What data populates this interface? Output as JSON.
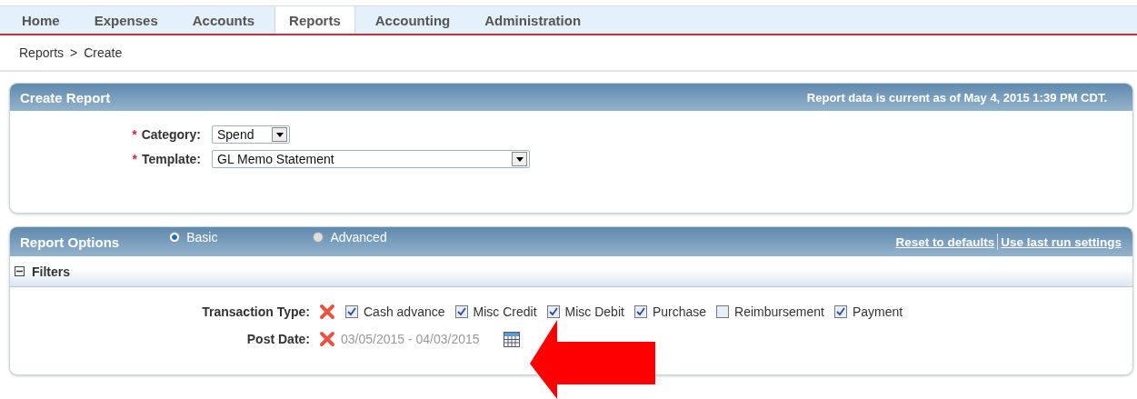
{
  "nav": {
    "tabs": [
      {
        "label": "Home",
        "selected": false
      },
      {
        "label": "Expenses",
        "selected": false
      },
      {
        "label": "Accounts",
        "selected": false
      },
      {
        "label": "Reports",
        "selected": true
      },
      {
        "label": "Accounting",
        "selected": false
      },
      {
        "label": "Administration",
        "selected": false
      }
    ]
  },
  "breadcrumb": {
    "items": [
      "Reports",
      "Create"
    ],
    "separator": ">"
  },
  "create_report": {
    "title": "Create Report",
    "note": "Report data is current as of May 4, 2015 1:39 PM CDT.",
    "fields": [
      {
        "marker": "*",
        "label": "Category:",
        "value": "Spend",
        "kind": "short"
      },
      {
        "marker": "*",
        "label": "Template:",
        "value": "GL Memo Statement",
        "kind": "long"
      }
    ]
  },
  "report_options": {
    "title": "Report Options",
    "modes": [
      {
        "label": "Basic",
        "selected": true
      },
      {
        "label": "Advanced",
        "selected": false
      }
    ],
    "links": [
      "Reset to defaults",
      "Use last run settings"
    ],
    "filters": {
      "title": "Filters",
      "expanded": true,
      "transaction_type": {
        "label": "Transaction Type:",
        "options": [
          {
            "label": "Cash advance",
            "checked": true
          },
          {
            "label": "Misc Credit",
            "checked": true
          },
          {
            "label": "Misc Debit",
            "checked": true
          },
          {
            "label": "Purchase",
            "checked": true
          },
          {
            "label": "Reimbursement",
            "checked": false
          },
          {
            "label": "Payment",
            "checked": true
          }
        ]
      },
      "post_date": {
        "label": "Post Date:",
        "value": "03/05/2015 - 04/03/2015"
      }
    }
  }
}
